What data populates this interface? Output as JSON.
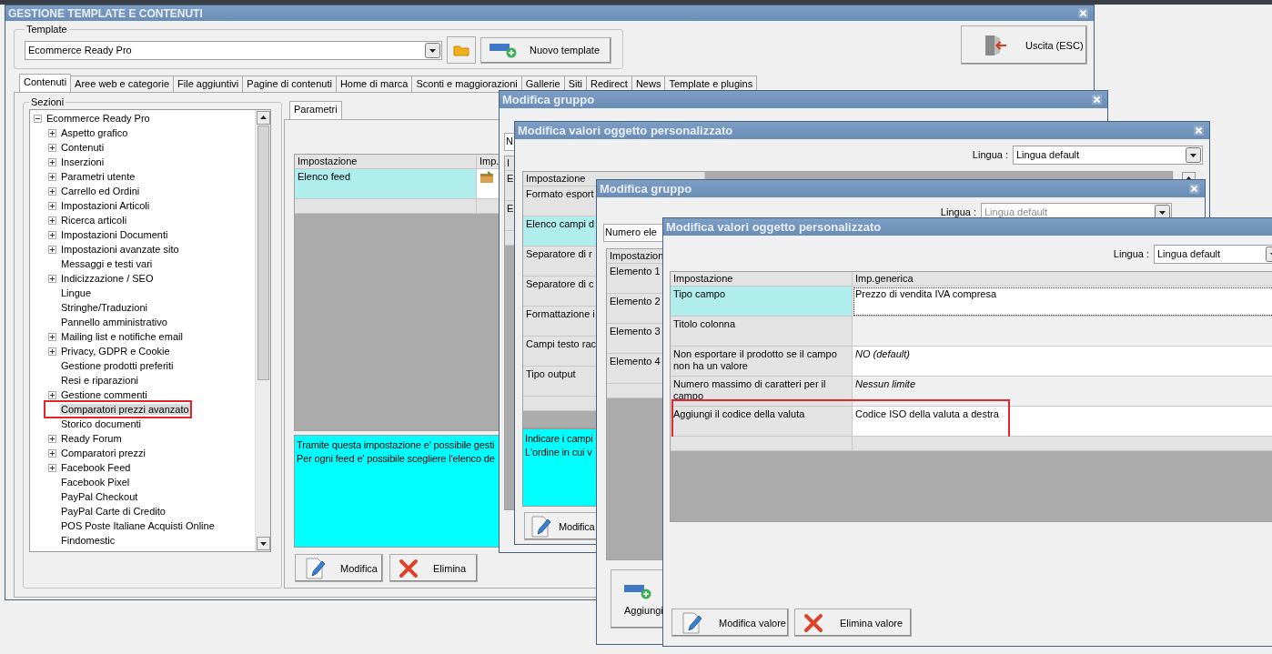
{
  "main_window": {
    "title": "GESTIONE TEMPLATE E CONTENUTI",
    "template_group": {
      "label": "Template",
      "value": "Ecommerce Ready Pro",
      "new_button": "Nuovo template"
    },
    "exit_button": "Uscita (ESC)",
    "tabs": [
      {
        "label": "Contenuti",
        "selected": true
      },
      {
        "label": "Aree web e categorie",
        "selected": false
      },
      {
        "label": "File aggiuntivi",
        "selected": false
      },
      {
        "label": "Pagine di contenuti",
        "selected": false
      },
      {
        "label": "Home di marca",
        "selected": false
      },
      {
        "label": "Sconti e maggiorazioni",
        "selected": false
      },
      {
        "label": "Gallerie",
        "selected": false
      },
      {
        "label": "Siti",
        "selected": false
      },
      {
        "label": "Redirect",
        "selected": false
      },
      {
        "label": "News",
        "selected": false
      },
      {
        "label": "Template e plugins",
        "selected": false
      }
    ],
    "sections_label": "Sezioni",
    "tree": [
      {
        "label": "Ecommerce Ready Pro",
        "expanded": true,
        "selected": false,
        "highlighted": false,
        "children": [
          {
            "label": "Aspetto grafico",
            "expanded": false,
            "selected": false,
            "highlighted": false
          },
          {
            "label": "Contenuti",
            "expanded": false,
            "selected": false,
            "highlighted": false
          },
          {
            "label": "Inserzioni",
            "expanded": false,
            "selected": false,
            "highlighted": false
          },
          {
            "label": "Parametri utente",
            "expanded": false,
            "selected": false,
            "highlighted": false
          },
          {
            "label": "Carrello ed Ordini",
            "expanded": false,
            "selected": false,
            "highlighted": false
          },
          {
            "label": "Impostazioni Articoli",
            "expanded": false,
            "selected": false,
            "highlighted": false
          },
          {
            "label": "Ricerca articoli",
            "expanded": false,
            "selected": false,
            "highlighted": false
          },
          {
            "label": "Impostazioni Documenti",
            "expanded": false,
            "selected": false,
            "highlighted": false
          },
          {
            "label": "Impostazioni avanzate sito",
            "expanded": false,
            "selected": false,
            "highlighted": false
          },
          {
            "label": "Messaggi e testi vari",
            "selected": false,
            "highlighted": false
          },
          {
            "label": "Indicizzazione / SEO",
            "expanded": false,
            "selected": false,
            "highlighted": false
          },
          {
            "label": "Lingue",
            "selected": false,
            "highlighted": false
          },
          {
            "label": "Stringhe/Traduzioni",
            "selected": false,
            "highlighted": false
          },
          {
            "label": "Pannello amministrativo",
            "selected": false,
            "highlighted": false
          },
          {
            "label": "Mailing list e notifiche email",
            "expanded": false,
            "selected": false,
            "highlighted": false
          },
          {
            "label": "Privacy, GDPR e Cookie",
            "expanded": false,
            "selected": false,
            "highlighted": false
          },
          {
            "label": "Gestione prodotti preferiti",
            "selected": false,
            "highlighted": false
          },
          {
            "label": "Resi e riparazioni",
            "selected": false,
            "highlighted": false
          },
          {
            "label": "Gestione commenti",
            "expanded": false,
            "selected": false,
            "highlighted": false
          },
          {
            "label": "Comparatori prezzi avanzato",
            "selected": true,
            "highlighted": true
          },
          {
            "label": "Storico documenti",
            "selected": false,
            "highlighted": false
          },
          {
            "label": "Ready Forum",
            "expanded": false,
            "selected": false,
            "highlighted": false
          },
          {
            "label": "Comparatori prezzi",
            "expanded": false,
            "selected": false,
            "highlighted": false
          },
          {
            "label": "Facebook Feed",
            "expanded": false,
            "selected": false,
            "highlighted": false
          },
          {
            "label": "Facebook Pixel",
            "selected": false,
            "highlighted": false
          },
          {
            "label": "PayPal Checkout",
            "selected": false,
            "highlighted": false
          },
          {
            "label": "PayPal Carte di Credito",
            "selected": false,
            "highlighted": false
          },
          {
            "label": "POS Poste Italiane Acquisti Online",
            "selected": false,
            "highlighted": false
          },
          {
            "label": "Findomestic",
            "selected": false,
            "highlighted": false
          }
        ]
      }
    ],
    "param_tabs": [
      {
        "label": "Parametri",
        "selected": true
      }
    ],
    "grid": {
      "kind": "settings",
      "columns": [
        "Impostazione",
        "Imp."
      ],
      "rows": [
        {
          "setting": "Elenco feed",
          "kind": "list",
          "selected": true
        }
      ]
    },
    "description": [
      "Tramite questa impostazione e' possibile gesti",
      "Per ogni feed e' possibile scegliere l'elenco de"
    ],
    "buttons": [
      {
        "label": "Modifica",
        "kind": "edit"
      },
      {
        "label": "Elimina",
        "kind": "delete"
      }
    ]
  },
  "dialogs": [
    {
      "title": "Modifica gruppo",
      "has_close": true,
      "count_field": "N",
      "grid": {
        "kind": "list",
        "columns": [
          "I"
        ],
        "rows": [
          {
            "setting": "E",
            "selected": false
          },
          {
            "setting": "E",
            "selected": false
          }
        ]
      }
    },
    {
      "title": "Modifica valori oggetto personalizzato",
      "has_close": true,
      "language": {
        "label": "Lingua :",
        "value": "Lingua default",
        "disabled": false
      },
      "grid": {
        "kind": "list",
        "columns": [
          "Impostazione"
        ],
        "rows": [
          {
            "setting": "Formato esport",
            "selected": false
          },
          {
            "setting": "Elenco campi d",
            "selected": true
          },
          {
            "setting": "Separatore di r",
            "selected": false
          },
          {
            "setting": "Separatore di c",
            "selected": false
          },
          {
            "setting": "Formattazione i",
            "selected": false
          },
          {
            "setting": "Campi testo rac",
            "selected": false
          },
          {
            "setting": "Tipo output",
            "selected": false
          }
        ]
      },
      "description": [
        "Indicare i campi",
        "L'ordine in cui v"
      ],
      "buttons": [
        {
          "label": "Modifica",
          "kind": "edit"
        }
      ]
    },
    {
      "title": "Modifica gruppo",
      "has_close": true,
      "language": {
        "label": "Lingua :",
        "value": "Lingua default",
        "disabled": true
      },
      "count_field": "Numero ele",
      "grid": {
        "kind": "list",
        "columns": [
          "Impostazion"
        ],
        "rows": [
          {
            "setting": "Elemento 1",
            "selected": false
          },
          {
            "setting": "Elemento 2",
            "selected": false
          },
          {
            "setting": "Elemento 3",
            "selected": false
          },
          {
            "setting": "Elemento 4",
            "selected": false
          }
        ]
      },
      "buttons": [
        {
          "label": "Aggiungi",
          "kind": "add"
        }
      ]
    },
    {
      "title": "Modifica valori oggetto personalizzato",
      "has_close": false,
      "language": {
        "label": "Lingua :",
        "value": "Lingua default",
        "disabled": false
      },
      "grid": {
        "kind": "settings",
        "columns": [
          "Impostazione",
          "Imp.generica"
        ],
        "rows": [
          {
            "setting": "Tipo campo",
            "value": "Prezzo di vendita IVA compresa",
            "is_default": false,
            "selected": true,
            "highlighted": false
          },
          {
            "setting": "Titolo colonna",
            "selected": false,
            "highlighted": false
          },
          {
            "setting": "Non esportare il prodotto se il campo non ha un valore",
            "value": "NO (default)",
            "is_default": true,
            "selected": false,
            "highlighted": false
          },
          {
            "setting": "Numero massimo di caratteri per il campo",
            "value": "Nessun limite",
            "is_default": true,
            "selected": false,
            "highlighted": false
          },
          {
            "setting": "Aggiungi il codice della valuta",
            "value": "Codice ISO della valuta a destra",
            "is_default": false,
            "selected": false,
            "highlighted": true
          }
        ]
      },
      "buttons": [
        {
          "label": "Modifica valore",
          "kind": "edit"
        },
        {
          "label": "Elimina valore",
          "kind": "delete"
        }
      ]
    }
  ]
}
